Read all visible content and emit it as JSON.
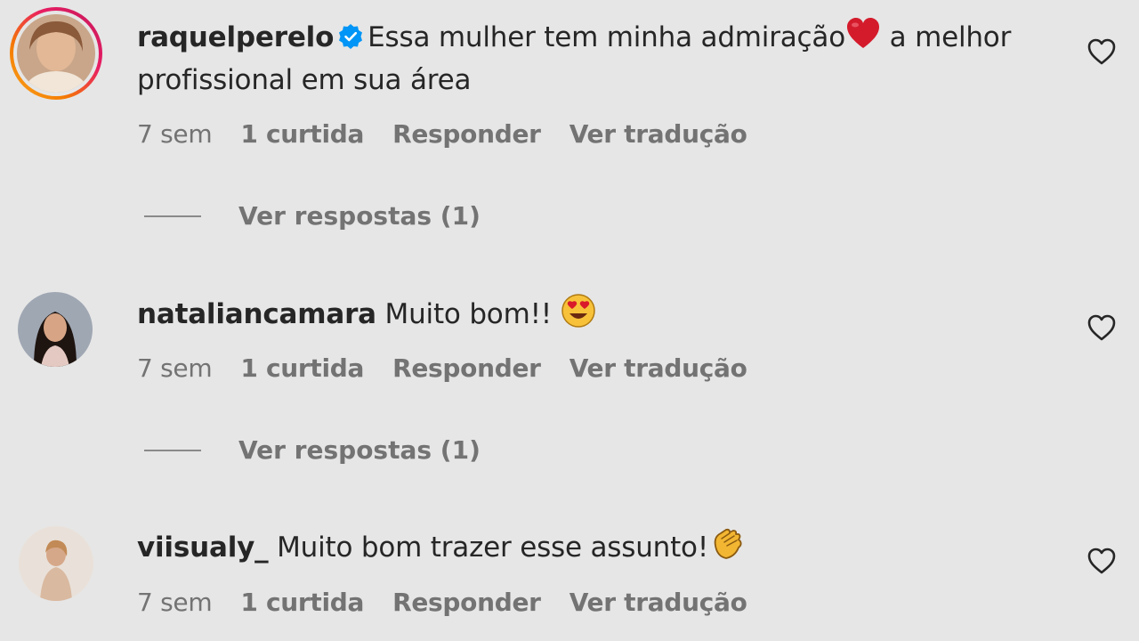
{
  "comments": [
    {
      "username": "raquelperelo",
      "verified": true,
      "text_before": "Essa mulher tem minha admiração",
      "emoji": "red-heart",
      "text_after": " a melhor profissional em sua área",
      "time": "7 sem",
      "likes": "1 curtida",
      "reply": "Responder",
      "translate": "Ver tradução",
      "view_replies": "Ver respostas (1)"
    },
    {
      "username": "nataliancamara",
      "verified": false,
      "text_before": "Muito bom!! ",
      "emoji": "heart-eyes",
      "text_after": "",
      "time": "7 sem",
      "likes": "1 curtida",
      "reply": "Responder",
      "translate": "Ver tradução",
      "view_replies": "Ver respostas (1)"
    },
    {
      "username": "viisualy_",
      "verified": false,
      "text_before": "Muito bom trazer esse assunto!",
      "emoji": "clapping-hands",
      "text_after": "",
      "time": "7 sem",
      "likes": "1 curtida",
      "reply": "Responder",
      "translate": "Ver tradução"
    }
  ],
  "colors": {
    "background": "#e6e6e6",
    "text": "#262626",
    "muted": "#737373",
    "verified": "#0095f6"
  }
}
